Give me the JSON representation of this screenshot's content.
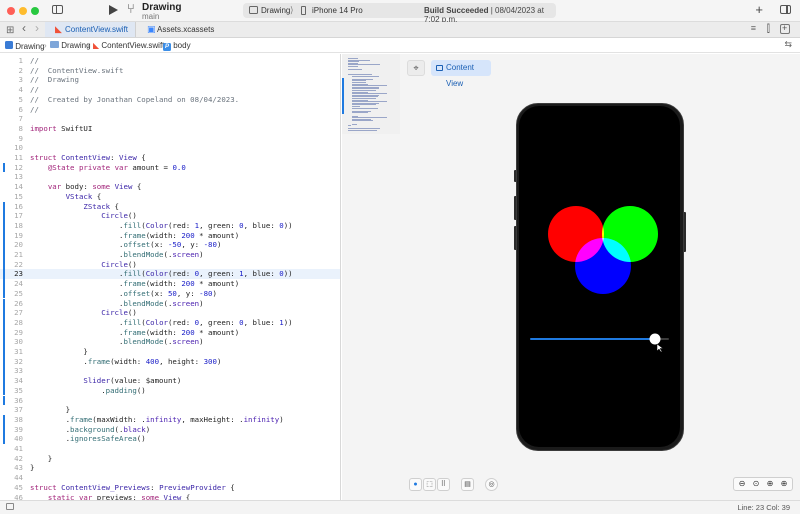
{
  "window": {
    "project_name": "Drawing",
    "branch": "main",
    "scheme": "Drawing",
    "scheme_separator": "⟩",
    "device": "iPhone 14 Pro",
    "build_status_bold": "Build Succeeded",
    "build_status_rest": " | 08/04/2023 at 7:02 p.m."
  },
  "tabs": [
    {
      "label": "ContentView.swift",
      "icon": "swift-file-icon",
      "active": true
    },
    {
      "label": "Assets.xcassets",
      "icon": "asset-catalog-icon",
      "active": false
    }
  ],
  "breadcrumb": [
    "Drawing",
    "Drawing",
    "ContentView.swift",
    "body"
  ],
  "editor": {
    "active_line": 23,
    "lines": [
      {
        "n": "1",
        "h": "<span class='cm'>//</span>"
      },
      {
        "n": "2",
        "h": "<span class='cm'>//  ContentView.swift</span>"
      },
      {
        "n": "3",
        "h": "<span class='cm'>//  Drawing</span>"
      },
      {
        "n": "4",
        "h": "<span class='cm'>//</span>"
      },
      {
        "n": "5",
        "h": "<span class='cm'>//  Created by Jonathan Copeland on 08/04/2023.</span>"
      },
      {
        "n": "6",
        "h": "<span class='cm'>//</span>"
      },
      {
        "n": "7",
        "h": ""
      },
      {
        "n": "8",
        "h": "<span class='kw'>import</span> SwiftUI"
      },
      {
        "n": "9",
        "h": ""
      },
      {
        "n": "10",
        "h": ""
      },
      {
        "n": "11",
        "h": "<span class='kw'>struct</span> <span class='ty'>ContentView</span>: <span class='ty'>View</span> {"
      },
      {
        "n": "12",
        "h": "    <span class='kw'>@State</span> <span class='kw'>private</span> <span class='kw'>var</span> amount = <span class='nm'>0.0</span>"
      },
      {
        "n": "13",
        "h": ""
      },
      {
        "n": "14",
        "h": "    <span class='kw'>var</span> body: <span class='kw'>some</span> <span class='ty'>View</span> {"
      },
      {
        "n": "15",
        "h": "        <span class='ty'>VStack</span> {"
      },
      {
        "n": "16",
        "h": "            <span class='ty'>ZStack</span> {"
      },
      {
        "n": "17",
        "h": "                <span class='ty'>Circle</span>()"
      },
      {
        "n": "18",
        "h": "                    .<span class='fn'>fill</span>(<span class='ty'>Color</span>(red: <span class='nm'>1</span>, green: <span class='nm'>0</span>, blue: <span class='nm'>0</span>))"
      },
      {
        "n": "19",
        "h": "                    .<span class='fn'>frame</span>(width: <span class='nm'>200</span> * amount)"
      },
      {
        "n": "20",
        "h": "                    .<span class='fn'>offset</span>(x: <span class='nm'>-50</span>, y: <span class='nm'>-80</span>)"
      },
      {
        "n": "21",
        "h": "                    .<span class='fn'>blendMode</span>(.<span class='pr'>screen</span>)"
      },
      {
        "n": "22",
        "h": "                <span class='ty'>Circle</span>()"
      },
      {
        "n": "23",
        "h": "                    .<span class='fn'>fill</span>(<span class='ty'>Color</span>(red: <span class='nm'>0</span>, green: <span class='nm'>1</span>, blue: <span class='nm'>0</span>))"
      },
      {
        "n": "24",
        "h": "                    .<span class='fn'>frame</span>(width: <span class='nm'>200</span> * amount)"
      },
      {
        "n": "25",
        "h": "                    .<span class='fn'>offset</span>(x: <span class='nm'>50</span>, y: <span class='nm'>-80</span>)"
      },
      {
        "n": "26",
        "h": "                    .<span class='fn'>blendMode</span>(.<span class='pr'>screen</span>)"
      },
      {
        "n": "27",
        "h": "                <span class='ty'>Circle</span>()"
      },
      {
        "n": "28",
        "h": "                    .<span class='fn'>fill</span>(<span class='ty'>Color</span>(red: <span class='nm'>0</span>, green: <span class='nm'>0</span>, blue: <span class='nm'>1</span>))"
      },
      {
        "n": "29",
        "h": "                    .<span class='fn'>frame</span>(width: <span class='nm'>200</span> * amount)"
      },
      {
        "n": "30",
        "h": "                    .<span class='fn'>blendMode</span>(.<span class='pr'>screen</span>)"
      },
      {
        "n": "31",
        "h": "            }"
      },
      {
        "n": "32",
        "h": "            .<span class='fn'>frame</span>(width: <span class='nm'>400</span>, height: <span class='nm'>300</span>)"
      },
      {
        "n": "33",
        "h": ""
      },
      {
        "n": "34",
        "h": "            <span class='ty'>Slider</span>(value: $amount)"
      },
      {
        "n": "35",
        "h": "                .<span class='fn'>padding</span>()"
      },
      {
        "n": "36",
        "h": ""
      },
      {
        "n": "37",
        "h": "        }"
      },
      {
        "n": "38",
        "h": "        .<span class='fn'>frame</span>(maxWidth: .<span class='pr'>infinity</span>, maxHeight: .<span class='pr'>infinity</span>)"
      },
      {
        "n": "39",
        "h": "        .<span class='fn'>background</span>(.<span class='pr'>black</span>)"
      },
      {
        "n": "40",
        "h": "        .<span class='fn'>ignoresSafeArea</span>()"
      },
      {
        "n": "41",
        "h": ""
      },
      {
        "n": "42",
        "h": "    }"
      },
      {
        "n": "43",
        "h": "}"
      },
      {
        "n": "44",
        "h": ""
      },
      {
        "n": "45",
        "h": "<span class='kw'>struct</span> <span class='ty'>ContentView_Previews</span>: <span class='ty'>PreviewProvider</span> {"
      },
      {
        "n": "46",
        "h": "    <span class='kw'>static</span> <span class='kw'>var</span> previews: <span class='kw'>some</span> <span class='ty'>View</span> {"
      }
    ],
    "changed_lines": [
      12,
      16,
      17,
      18,
      19,
      20,
      21,
      22,
      23,
      24,
      25,
      26,
      27,
      28,
      29,
      30,
      31,
      32,
      33,
      34,
      35,
      36,
      38,
      39,
      40
    ]
  },
  "preview": {
    "label": "Content View",
    "slider_fraction": 0.92,
    "circle_colors": {
      "red": "#ff0000",
      "green": "#00ff00",
      "blue": "#0000ff"
    },
    "slider_track_color": "#1f7ae0"
  },
  "status": {
    "position": "Line: 23  Col: 39"
  }
}
